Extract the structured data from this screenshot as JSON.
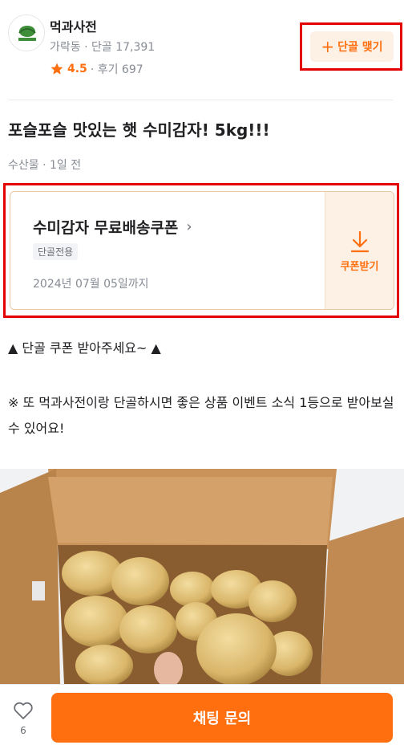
{
  "store": {
    "name": "먹과사전",
    "meta": "가락동 · 단골 17,391",
    "rating": "4.5",
    "reviews": "· 후기 697",
    "follow_label": "단골 맺기",
    "logo_text": "먹과사전"
  },
  "post": {
    "title": "포슬포슬 맛있는 햇 수미감자! 5kg!!!",
    "meta": "수산물 · 1일 전"
  },
  "coupon": {
    "name": "수미감자 무료배송쿠폰",
    "tag": "단골전용",
    "expiry": "2024년 07월 05일까지",
    "get_label": "쿠폰받기"
  },
  "description": {
    "line1": "▲ 단골 쿠폰 받아주세요~ ▲",
    "line2": "※ 또 먹과사전이랑 단골하시면 좋은 상품 이벤트 소식 1등으로 받아보실 수 있어요!"
  },
  "bottom": {
    "like_count": "6",
    "chat_label": "채팅 문의"
  },
  "colors": {
    "accent": "#ff6f0f",
    "accent_bg": "#fdf0e4",
    "highlight_box": "#e30000"
  },
  "icons": {
    "follow": "plus-icon",
    "rating": "star-icon",
    "coupon_chevron": "chevron-right-icon",
    "coupon_get": "download-icon",
    "like": "heart-icon"
  }
}
